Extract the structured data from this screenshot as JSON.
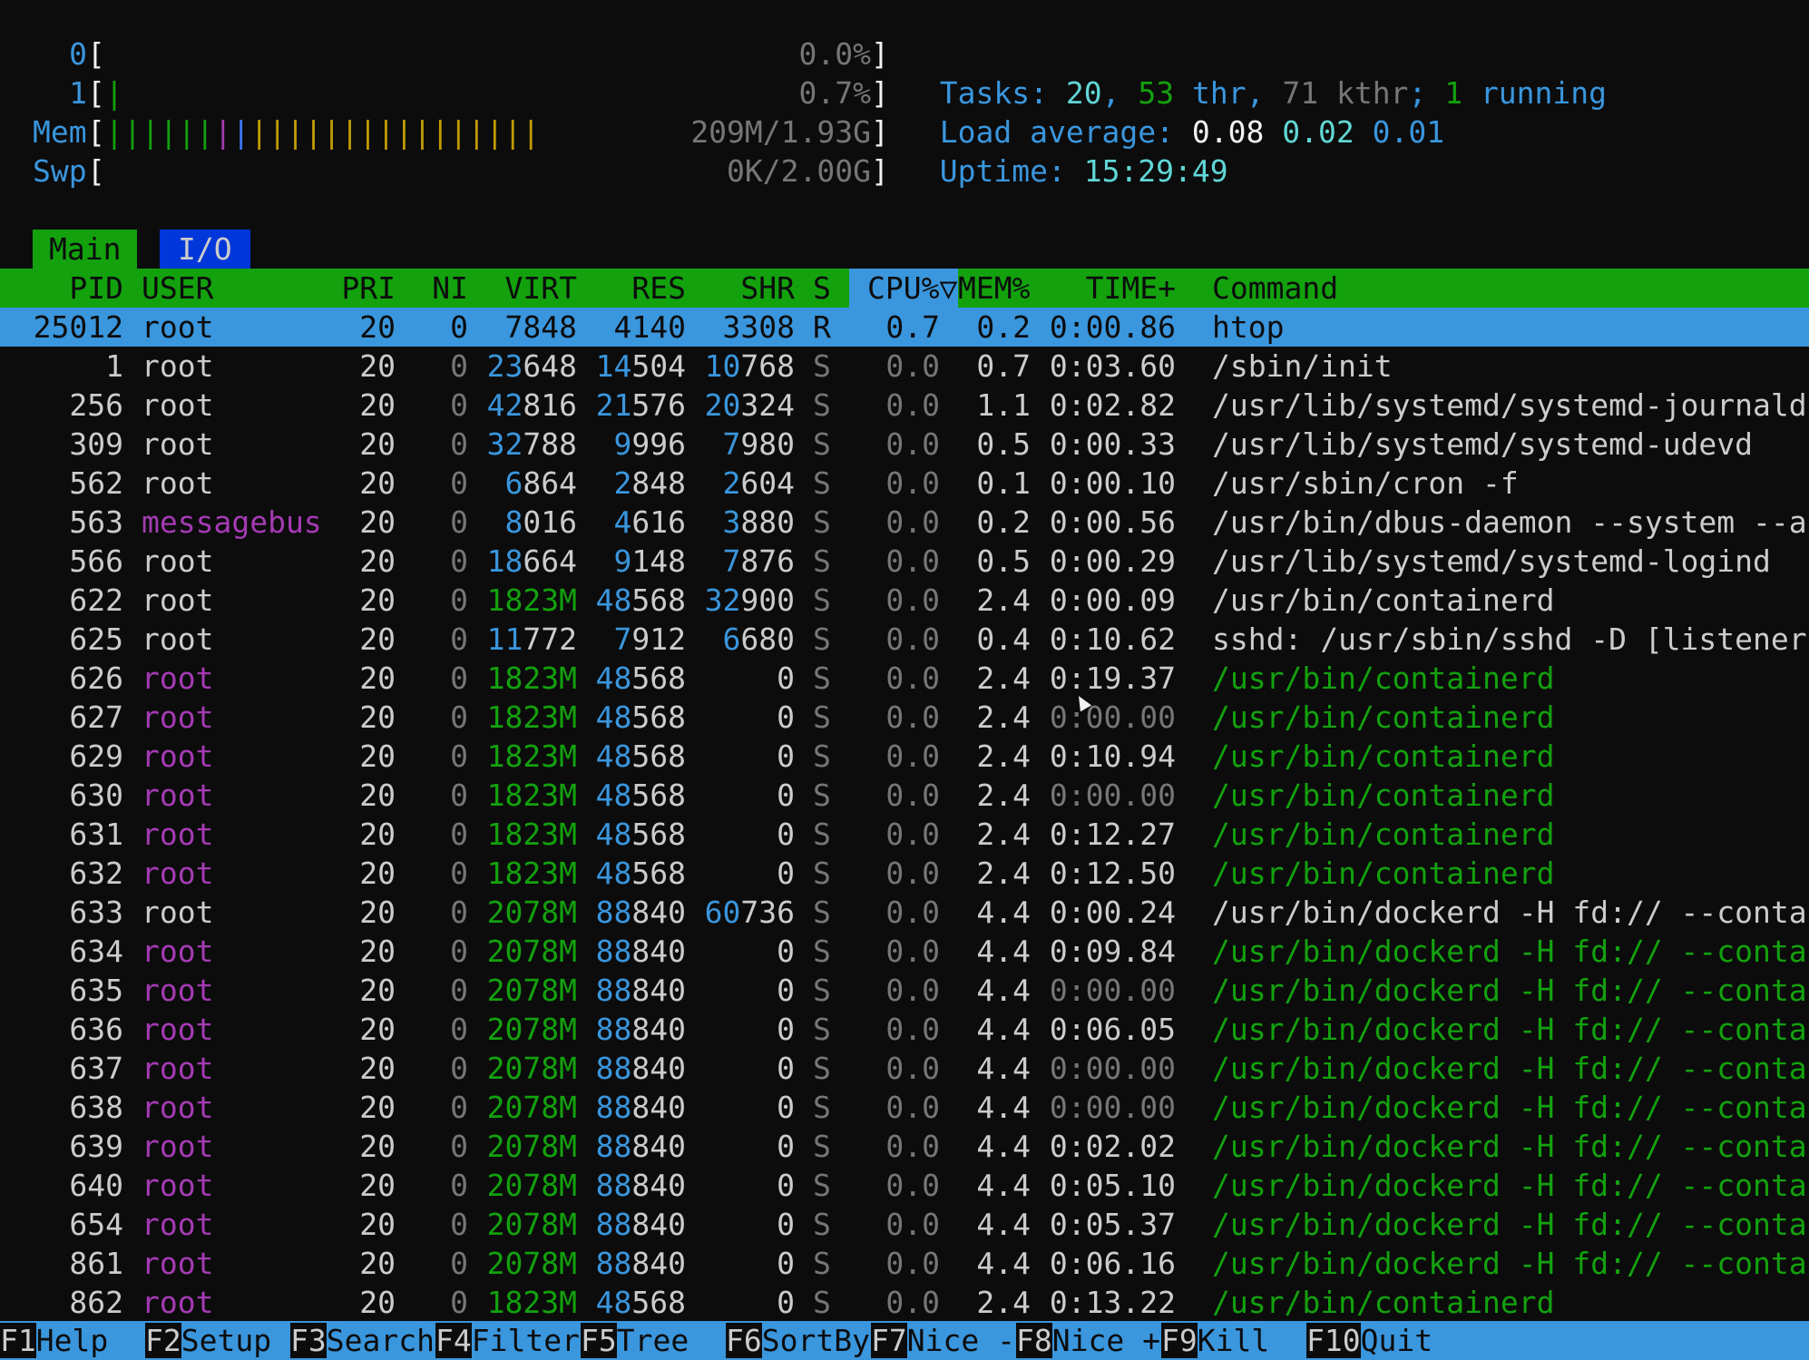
{
  "meters": {
    "cpu0": {
      "label": "0",
      "bars": "",
      "value": "0.0%"
    },
    "cpu1": {
      "label": "1",
      "bars": "|",
      "value": "0.7%"
    },
    "mem": {
      "label": "Mem",
      "bars_green": "||||||",
      "bars_magenta": "|",
      "bars_blue": "|",
      "bars_yellow": "||||||||||||||||",
      "value": "209M/1.93G"
    },
    "swp": {
      "label": "Swp",
      "bars": "",
      "value": "0K/2.00G"
    }
  },
  "stats": {
    "tasks_label": "Tasks:",
    "tasks": "20",
    "thr": "53",
    "thr_label": "thr",
    "kthr": "71",
    "kthr_label": "kthr",
    "running": "1",
    "running_label": "running",
    "load_label": "Load average:",
    "load1": "0.08",
    "load5": "0.02",
    "load15": "0.01",
    "uptime_label": "Uptime:",
    "uptime": "15:29:49"
  },
  "tabs": [
    "Main",
    "I/O"
  ],
  "columns": {
    "pid": "PID",
    "user": "USER",
    "pri": "PRI",
    "ni": "NI",
    "virt": "VIRT",
    "res": "RES",
    "shr": "SHR",
    "s": "S",
    "cpu": "CPU%▽",
    "mem": "MEM%",
    "time": "TIME+",
    "command": "Command"
  },
  "processes": [
    {
      "pid": "25012",
      "user": "root",
      "pri": "20",
      "ni": "0",
      "virt": "7848",
      "res": "4140",
      "shr": "3308",
      "s": "R",
      "cpu": "0.7",
      "mem": "0.2",
      "time": "0:00.86",
      "command": "htop",
      "thread": false,
      "selected": true
    },
    {
      "pid": "1",
      "user": "root",
      "pri": "20",
      "ni": "0",
      "virt": "23648",
      "res": "14504",
      "shr": "10768",
      "s": "S",
      "cpu": "0.0",
      "mem": "0.7",
      "time": "0:03.60",
      "command": "/sbin/init",
      "thread": false
    },
    {
      "pid": "256",
      "user": "root",
      "pri": "20",
      "ni": "0",
      "virt": "42816",
      "res": "21576",
      "shr": "20324",
      "s": "S",
      "cpu": "0.0",
      "mem": "1.1",
      "time": "0:02.82",
      "command": "/usr/lib/systemd/systemd-journald",
      "thread": false
    },
    {
      "pid": "309",
      "user": "root",
      "pri": "20",
      "ni": "0",
      "virt": "32788",
      "res": "9996",
      "shr": "7980",
      "s": "S",
      "cpu": "0.0",
      "mem": "0.5",
      "time": "0:00.33",
      "command": "/usr/lib/systemd/systemd-udevd",
      "thread": false
    },
    {
      "pid": "562",
      "user": "root",
      "pri": "20",
      "ni": "0",
      "virt": "6864",
      "res": "2848",
      "shr": "2604",
      "s": "S",
      "cpu": "0.0",
      "mem": "0.1",
      "time": "0:00.10",
      "command": "/usr/sbin/cron -f",
      "thread": false
    },
    {
      "pid": "563",
      "user": "messagebus",
      "pri": "20",
      "ni": "0",
      "virt": "8016",
      "res": "4616",
      "shr": "3880",
      "s": "S",
      "cpu": "0.0",
      "mem": "0.2",
      "time": "0:00.56",
      "command": "/usr/bin/dbus-daemon --system --a",
      "thread": false
    },
    {
      "pid": "566",
      "user": "root",
      "pri": "20",
      "ni": "0",
      "virt": "18664",
      "res": "9148",
      "shr": "7876",
      "s": "S",
      "cpu": "0.0",
      "mem": "0.5",
      "time": "0:00.29",
      "command": "/usr/lib/systemd/systemd-logind",
      "thread": false
    },
    {
      "pid": "622",
      "user": "root",
      "pri": "20",
      "ni": "0",
      "virt": "1823M",
      "res": "48568",
      "shr": "32900",
      "s": "S",
      "cpu": "0.0",
      "mem": "2.4",
      "time": "0:00.09",
      "command": "/usr/bin/containerd",
      "thread": false
    },
    {
      "pid": "625",
      "user": "root",
      "pri": "20",
      "ni": "0",
      "virt": "11772",
      "res": "7912",
      "shr": "6680",
      "s": "S",
      "cpu": "0.0",
      "mem": "0.4",
      "time": "0:10.62",
      "command": "sshd: /usr/sbin/sshd -D [listener",
      "thread": false
    },
    {
      "pid": "626",
      "user": "root",
      "pri": "20",
      "ni": "0",
      "virt": "1823M",
      "res": "48568",
      "shr": "0",
      "s": "S",
      "cpu": "0.0",
      "mem": "2.4",
      "time": "0:19.37",
      "command": "/usr/bin/containerd",
      "thread": true
    },
    {
      "pid": "627",
      "user": "root",
      "pri": "20",
      "ni": "0",
      "virt": "1823M",
      "res": "48568",
      "shr": "0",
      "s": "S",
      "cpu": "0.0",
      "mem": "2.4",
      "time": "0:00.00",
      "command": "/usr/bin/containerd",
      "thread": true
    },
    {
      "pid": "629",
      "user": "root",
      "pri": "20",
      "ni": "0",
      "virt": "1823M",
      "res": "48568",
      "shr": "0",
      "s": "S",
      "cpu": "0.0",
      "mem": "2.4",
      "time": "0:10.94",
      "command": "/usr/bin/containerd",
      "thread": true
    },
    {
      "pid": "630",
      "user": "root",
      "pri": "20",
      "ni": "0",
      "virt": "1823M",
      "res": "48568",
      "shr": "0",
      "s": "S",
      "cpu": "0.0",
      "mem": "2.4",
      "time": "0:00.00",
      "command": "/usr/bin/containerd",
      "thread": true
    },
    {
      "pid": "631",
      "user": "root",
      "pri": "20",
      "ni": "0",
      "virt": "1823M",
      "res": "48568",
      "shr": "0",
      "s": "S",
      "cpu": "0.0",
      "mem": "2.4",
      "time": "0:12.27",
      "command": "/usr/bin/containerd",
      "thread": true
    },
    {
      "pid": "632",
      "user": "root",
      "pri": "20",
      "ni": "0",
      "virt": "1823M",
      "res": "48568",
      "shr": "0",
      "s": "S",
      "cpu": "0.0",
      "mem": "2.4",
      "time": "0:12.50",
      "command": "/usr/bin/containerd",
      "thread": true
    },
    {
      "pid": "633",
      "user": "root",
      "pri": "20",
      "ni": "0",
      "virt": "2078M",
      "res": "88840",
      "shr": "60736",
      "s": "S",
      "cpu": "0.0",
      "mem": "4.4",
      "time": "0:00.24",
      "command": "/usr/bin/dockerd -H fd:// --conta",
      "thread": false
    },
    {
      "pid": "634",
      "user": "root",
      "pri": "20",
      "ni": "0",
      "virt": "2078M",
      "res": "88840",
      "shr": "0",
      "s": "S",
      "cpu": "0.0",
      "mem": "4.4",
      "time": "0:09.84",
      "command": "/usr/bin/dockerd -H fd:// --conta",
      "thread": true
    },
    {
      "pid": "635",
      "user": "root",
      "pri": "20",
      "ni": "0",
      "virt": "2078M",
      "res": "88840",
      "shr": "0",
      "s": "S",
      "cpu": "0.0",
      "mem": "4.4",
      "time": "0:00.00",
      "command": "/usr/bin/dockerd -H fd:// --conta",
      "thread": true
    },
    {
      "pid": "636",
      "user": "root",
      "pri": "20",
      "ni": "0",
      "virt": "2078M",
      "res": "88840",
      "shr": "0",
      "s": "S",
      "cpu": "0.0",
      "mem": "4.4",
      "time": "0:06.05",
      "command": "/usr/bin/dockerd -H fd:// --conta",
      "thread": true
    },
    {
      "pid": "637",
      "user": "root",
      "pri": "20",
      "ni": "0",
      "virt": "2078M",
      "res": "88840",
      "shr": "0",
      "s": "S",
      "cpu": "0.0",
      "mem": "4.4",
      "time": "0:00.00",
      "command": "/usr/bin/dockerd -H fd:// --conta",
      "thread": true
    },
    {
      "pid": "638",
      "user": "root",
      "pri": "20",
      "ni": "0",
      "virt": "2078M",
      "res": "88840",
      "shr": "0",
      "s": "S",
      "cpu": "0.0",
      "mem": "4.4",
      "time": "0:00.00",
      "command": "/usr/bin/dockerd -H fd:// --conta",
      "thread": true
    },
    {
      "pid": "639",
      "user": "root",
      "pri": "20",
      "ni": "0",
      "virt": "2078M",
      "res": "88840",
      "shr": "0",
      "s": "S",
      "cpu": "0.0",
      "mem": "4.4",
      "time": "0:02.02",
      "command": "/usr/bin/dockerd -H fd:// --conta",
      "thread": true
    },
    {
      "pid": "640",
      "user": "root",
      "pri": "20",
      "ni": "0",
      "virt": "2078M",
      "res": "88840",
      "shr": "0",
      "s": "S",
      "cpu": "0.0",
      "mem": "4.4",
      "time": "0:05.10",
      "command": "/usr/bin/dockerd -H fd:// --conta",
      "thread": true
    },
    {
      "pid": "654",
      "user": "root",
      "pri": "20",
      "ni": "0",
      "virt": "2078M",
      "res": "88840",
      "shr": "0",
      "s": "S",
      "cpu": "0.0",
      "mem": "4.4",
      "time": "0:05.37",
      "command": "/usr/bin/dockerd -H fd:// --conta",
      "thread": true
    },
    {
      "pid": "861",
      "user": "root",
      "pri": "20",
      "ni": "0",
      "virt": "2078M",
      "res": "88840",
      "shr": "0",
      "s": "S",
      "cpu": "0.0",
      "mem": "4.4",
      "time": "0:06.16",
      "command": "/usr/bin/dockerd -H fd:// --conta",
      "thread": true
    },
    {
      "pid": "862",
      "user": "root",
      "pri": "20",
      "ni": "0",
      "virt": "1823M",
      "res": "48568",
      "shr": "0",
      "s": "S",
      "cpu": "0.0",
      "mem": "2.4",
      "time": "0:13.22",
      "command": "/usr/bin/containerd",
      "thread": true
    }
  ],
  "function_keys": [
    {
      "key": "F1",
      "label": "Help"
    },
    {
      "key": "F2",
      "label": "Setup"
    },
    {
      "key": "F3",
      "label": "Search"
    },
    {
      "key": "F4",
      "label": "Filter"
    },
    {
      "key": "F5",
      "label": "Tree"
    },
    {
      "key": "F6",
      "label": "SortBy"
    },
    {
      "key": "F7",
      "label": "Nice -"
    },
    {
      "key": "F8",
      "label": "Nice +"
    },
    {
      "key": "F9",
      "label": "Kill"
    },
    {
      "key": "F10",
      "label": "Quit"
    }
  ],
  "colors": {
    "background": "#0c0c0c",
    "header": "#13a10e",
    "selection": "#3a96dd",
    "thread": "#13a10e",
    "user_other": "#a43bb3"
  }
}
